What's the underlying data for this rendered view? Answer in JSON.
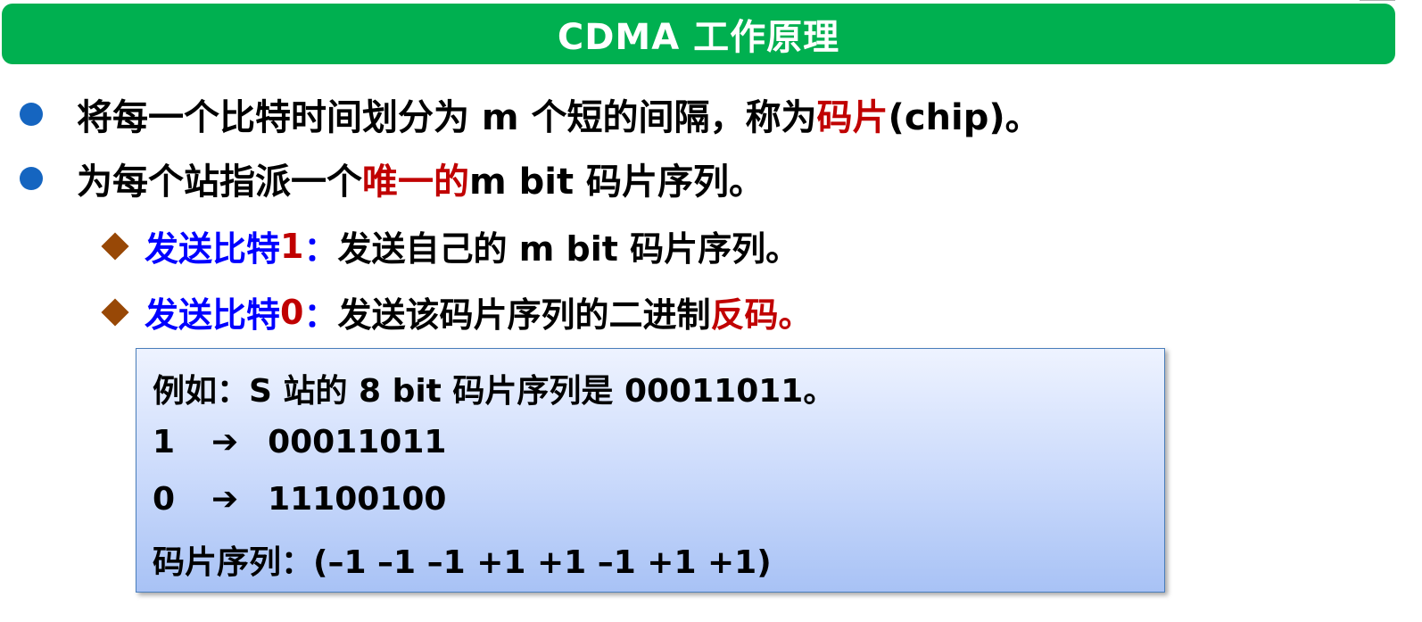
{
  "title": "CDMA 工作原理",
  "bullets": [
    {
      "pre": "将每一个比特时间划分为 m 个短的间隔，称为",
      "highlight": "码片",
      "post": " (chip)。"
    },
    {
      "pre": "为每个站指派一个",
      "highlight": "唯一的",
      "post": " m bit 码片序列。"
    }
  ],
  "sub_bullets": [
    {
      "label": "发送比特",
      "bit": " 1",
      "colon": "：",
      "text": "发送自己的 m bit 码片序列。",
      "highlight": ""
    },
    {
      "label": "发送比特",
      "bit": " 0",
      "colon": "：",
      "text": "发送该码片序列的二进制",
      "highlight": "反码。"
    }
  ],
  "example": {
    "intro": "例如：S 站的 8 bit 码片序列是 00011011。",
    "row1_bit": "1",
    "row1_seq": "00011011",
    "row2_bit": "0",
    "row2_seq": "11100100",
    "arrow_glyph": "➔",
    "chip_sequence": "码片序列：(–1 –1 –1 +1 +1 –1 +1 +1)"
  },
  "colors": {
    "title_bar": "#00b050",
    "bullet_dot": "#1565c0",
    "diamond": "#984806",
    "highlight_red": "#c00000",
    "highlight_blue": "#0000ff"
  }
}
